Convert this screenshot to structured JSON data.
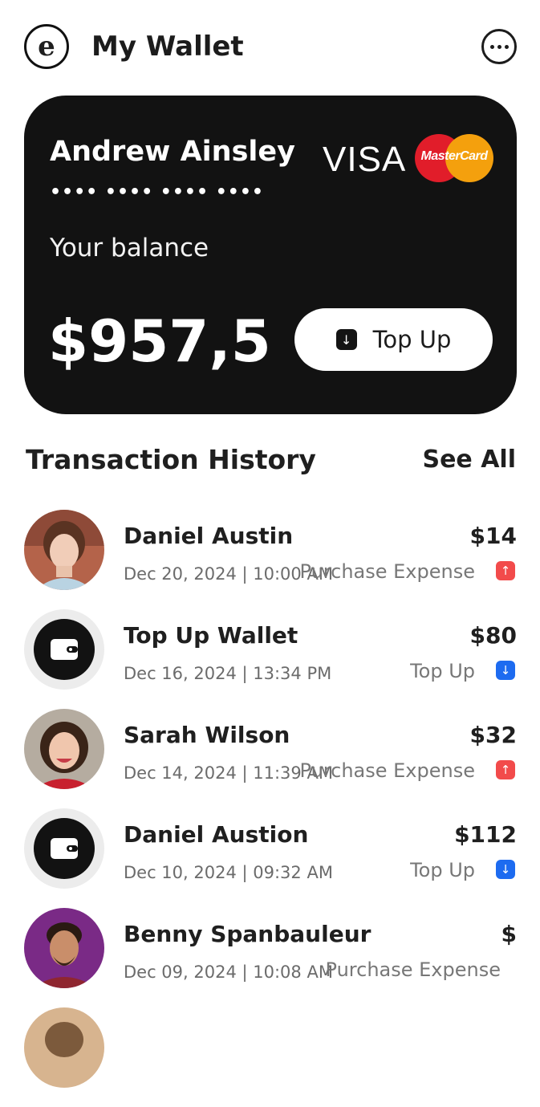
{
  "header": {
    "logo_letter": "e",
    "title": "My Wallet"
  },
  "card": {
    "holder": "Andrew Ainsley",
    "masked_number": "•••• •••• •••• ••••",
    "brand_visa": "VISA",
    "brand_mastercard": "MasterCard",
    "balance_label": "Your balance",
    "balance": "$957,5",
    "topup_label": "Top Up"
  },
  "history": {
    "title": "Transaction History",
    "see_all": "See All"
  },
  "transactions": [
    {
      "name": "Daniel Austin",
      "date": "Dec 20, 2024 | 10:00 AM",
      "type": "Purchase Expense",
      "amount": "$14",
      "direction": "out",
      "avatar": "person"
    },
    {
      "name": "Top Up Wallet",
      "date": "Dec 16, 2024 | 13:34 PM",
      "type": "Top Up",
      "amount": "$80",
      "direction": "in",
      "avatar": "wallet-icon"
    },
    {
      "name": "Sarah Wilson",
      "date": "Dec 14, 2024 | 11:39 AM",
      "type": "Purchase Expense",
      "amount": "$32",
      "direction": "out",
      "avatar": "person"
    },
    {
      "name": "Daniel Austion",
      "date": "Dec 10, 2024 | 09:32 AM",
      "type": "Top Up",
      "amount": "$112",
      "direction": "in",
      "avatar": "wallet-icon"
    },
    {
      "name": "Benny Spanbauleur",
      "date": "Dec 09, 2024 | 10:08 AM",
      "type": "Purchase Expense",
      "amount": "$",
      "direction": "",
      "avatar": "person"
    }
  ],
  "colors": {
    "card_bg": "#121212",
    "badge_out": "#f24b4b",
    "badge_in": "#1d6bf0"
  }
}
